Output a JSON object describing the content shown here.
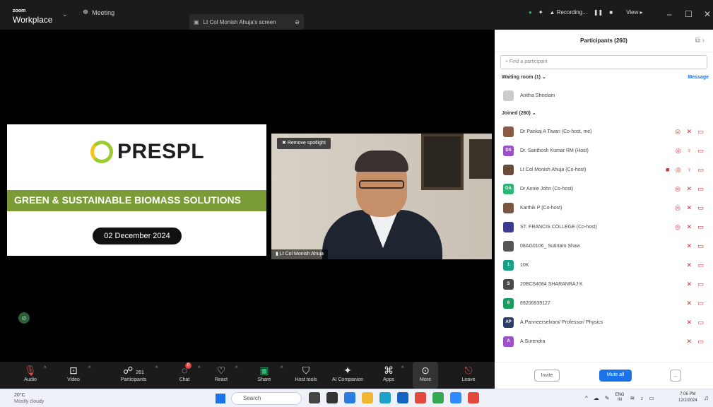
{
  "titlebar": {
    "brand_top": "zoom",
    "brand": "Workplace",
    "meeting_label": "Meeting",
    "share_label": "Lt Col Monish Ahuja's screen",
    "recording_label": "Recording...",
    "view_label": "View"
  },
  "slide": {
    "logo_text": "PRESPL",
    "banner": "GREEN & SUSTAINABLE BIOMASS SOLUTIONS",
    "date": "02 December 2024"
  },
  "video": {
    "spotlight_button": "Remove spotlight",
    "name": "Lt Col Monish Ahuja"
  },
  "toolbar": [
    {
      "label": "Audio",
      "icon": "mic-muted-icon"
    },
    {
      "label": "Video",
      "icon": "camera-off-icon"
    },
    {
      "label": "Participants",
      "icon": "participants-icon",
      "count": "261"
    },
    {
      "label": "Chat",
      "icon": "chat-icon",
      "badge": "8"
    },
    {
      "label": "React",
      "icon": "heart-icon"
    },
    {
      "label": "Share",
      "icon": "share-icon"
    },
    {
      "label": "Host tools",
      "icon": "shield-icon"
    },
    {
      "label": "AI Companion",
      "icon": "sparkle-icon"
    },
    {
      "label": "Apps",
      "icon": "apps-icon"
    },
    {
      "label": "More",
      "icon": "more-icon"
    },
    {
      "label": "Leave",
      "icon": "leave-icon"
    }
  ],
  "participants": {
    "title": "Participants (260)",
    "search_placeholder": "Find a participant",
    "waiting_header": "Waiting room (1)",
    "message_label": "Message",
    "waiting": [
      {
        "name": "Anitha Sheelam",
        "initials": "",
        "color": "#cccccc"
      }
    ],
    "joined_header": "Joined (260)",
    "joined": [
      {
        "name": "Dr Pankaj A Tiwari (Co-host, me)",
        "initials": "",
        "color": "#8a5a44",
        "icons": "◎ ✕ ▭"
      },
      {
        "name": "Dr. Santhosh Kumar RM (Host)",
        "initials": "DS",
        "color": "#9b4fc9",
        "icons": "◎ ♀ ▭"
      },
      {
        "name": "Lt Col Monish Ahuja (Co-host)",
        "initials": "",
        "color": "#6b4a3a",
        "icons": "■ ◎ ♀ ▭"
      },
      {
        "name": "Dr Annie John (Co-host)",
        "initials": "DA",
        "color": "#2bb673",
        "icons": "◎ ✕ ▭"
      },
      {
        "name": "Karthik P (Co-host)",
        "initials": "",
        "color": "#7a5540",
        "icons": "◎ ✕ ▭"
      },
      {
        "name": "ST. FRANCIS COLLEGE (Co-host)",
        "initials": "",
        "color": "#3b3b8f",
        "icons": "◎ ✕ ▭"
      },
      {
        "name": "08AG0106_ Sutirtam Shaw",
        "initials": "",
        "color": "#555555",
        "icons": "✕ ▭"
      },
      {
        "name": "10K",
        "initials": "1",
        "color": "#16a085",
        "icons": "✕ ▭"
      },
      {
        "name": "20BCS4084 SHARANRAJ K",
        "initials": "S",
        "color": "#4a4a4a",
        "icons": "✕ ▭"
      },
      {
        "name": "89206939127",
        "initials": "8",
        "color": "#1a9b5e",
        "icons": "✕ ▭"
      },
      {
        "name": "A.Panneerselvam/ Professor/ Physics",
        "initials": "AP",
        "color": "#2c3e6b",
        "icons": "✕ ▭"
      },
      {
        "name": "A.Surendra",
        "initials": "A",
        "color": "#9b4fc9",
        "icons": "✕ ▭"
      }
    ],
    "invite_label": "Invite",
    "mute_all_label": "Mute all",
    "more_label": "..."
  },
  "taskbar": {
    "temp": "20°C",
    "weather": "Mostly cloudy",
    "search": "Search",
    "lang": "ENG",
    "lang2": "IN",
    "time": "7:06 PM",
    "date": "12/2/2024"
  }
}
